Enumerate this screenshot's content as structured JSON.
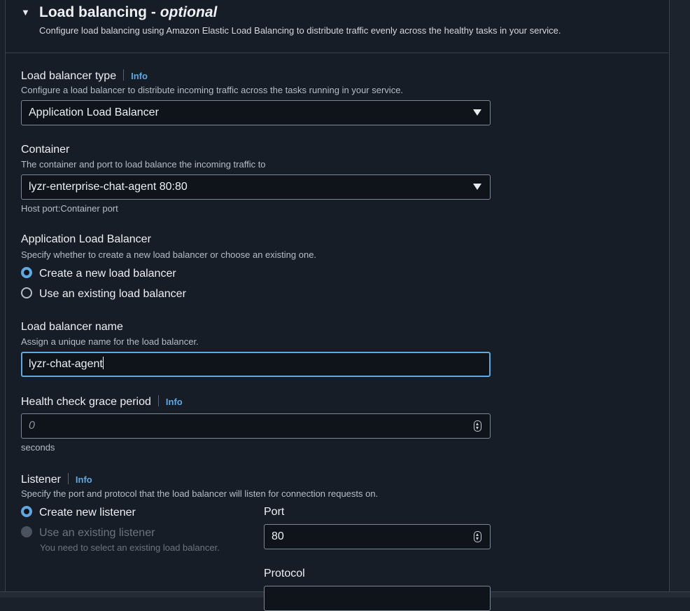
{
  "section": {
    "title": "Load balancing - ",
    "title_optional": "optional",
    "description": "Configure load balancing using Amazon Elastic Load Balancing to distribute traffic evenly across the healthy tasks in your service."
  },
  "lb_type": {
    "label": "Load balancer type",
    "info": "Info",
    "description": "Configure a load balancer to distribute incoming traffic across the tasks running in your service.",
    "value": "Application Load Balancer"
  },
  "container": {
    "label": "Container",
    "description": "The container and port to load balance the incoming traffic to",
    "value": "lyzr-enterprise-chat-agent 80:80",
    "hint": "Host port:Container port"
  },
  "alb": {
    "label": "Application Load Balancer",
    "description": "Specify whether to create a new load balancer or choose an existing one.",
    "options": [
      "Create a new load balancer",
      "Use an existing load balancer"
    ],
    "selected": "Create a new load balancer"
  },
  "lb_name": {
    "label": "Load balancer name",
    "description": "Assign a unique name for the load balancer.",
    "value": "lyzr-chat-agent"
  },
  "health_check": {
    "label": "Health check grace period",
    "info": "Info",
    "placeholder": "0",
    "unit": "seconds"
  },
  "listener": {
    "label": "Listener",
    "info": "Info",
    "description": "Specify the port and protocol that the load balancer will listen for connection requests on.",
    "options": [
      "Create new listener",
      "Use an existing listener"
    ],
    "selected": "Create new listener",
    "disabled_hint": "You need to select an existing load balancer.",
    "port_label": "Port",
    "port_value": "80",
    "protocol_label": "Protocol"
  },
  "colors": {
    "accent": "#5fa8e0",
    "panel": "#161d26",
    "border": "#7d8796"
  }
}
